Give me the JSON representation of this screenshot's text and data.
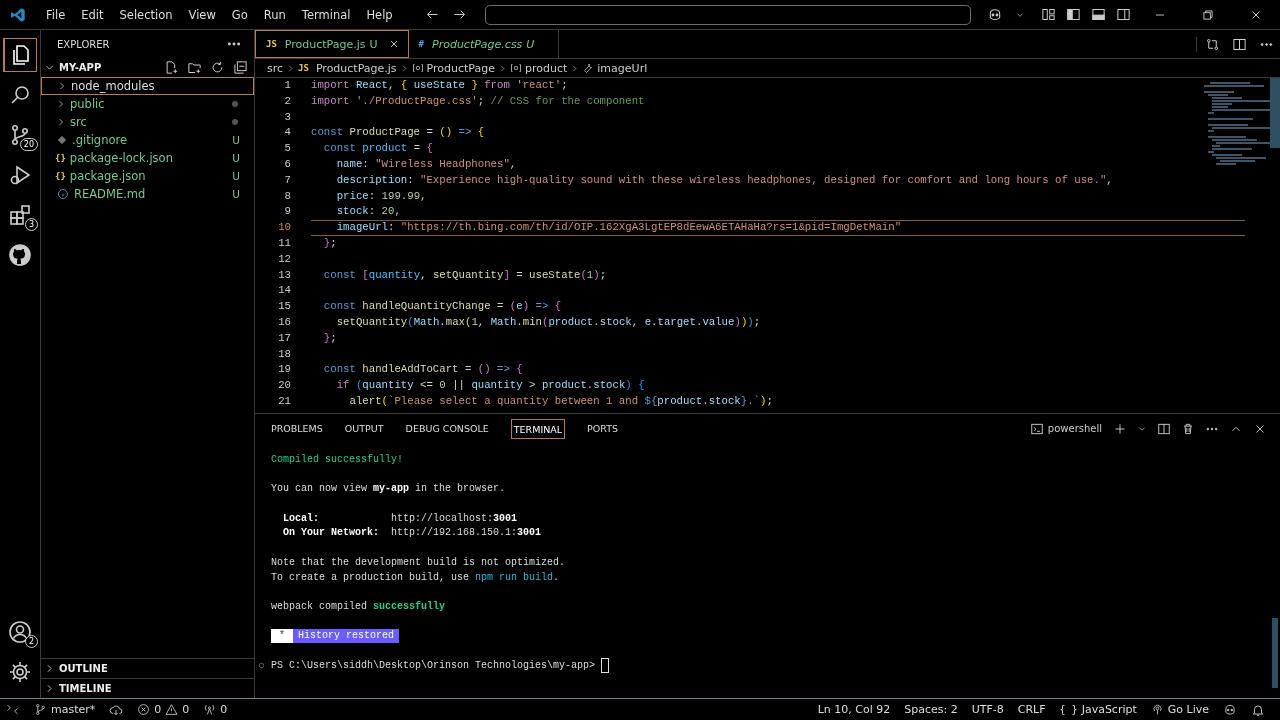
{
  "title_bar": {
    "menus": [
      "File",
      "Edit",
      "Selection",
      "View",
      "Go",
      "Run",
      "Terminal",
      "Help"
    ]
  },
  "activity_bar": {
    "top": [
      {
        "kind": "explorer",
        "selected": true
      },
      {
        "kind": "search",
        "selected": false
      },
      {
        "kind": "source_control",
        "selected": false,
        "badge": "20"
      },
      {
        "kind": "run_debug",
        "selected": false
      },
      {
        "kind": "extensions",
        "selected": false,
        "badge": "3"
      },
      {
        "kind": "github",
        "selected": false
      }
    ],
    "bottom": [
      {
        "kind": "accounts",
        "selected": false,
        "badge": "2"
      },
      {
        "kind": "settings",
        "selected": false
      }
    ]
  },
  "sidebar": {
    "title": "EXPLORER",
    "section": {
      "label": "MY-APP",
      "expanded": true
    },
    "items": [
      {
        "label": "node_modules",
        "kind": "folder",
        "ignored": true,
        "has_changes": false,
        "selected": true
      },
      {
        "label": "public",
        "kind": "folder",
        "ignored": false,
        "has_changes": true,
        "selected": false
      },
      {
        "label": "src",
        "kind": "folder",
        "ignored": false,
        "has_changes": true,
        "selected": false
      },
      {
        "label": ".gitignore",
        "kind": "gitignore",
        "ignored": false,
        "has_changes": false,
        "selected": false,
        "badge": "U"
      },
      {
        "label": "package-lock.json",
        "kind": "json",
        "ignored": false,
        "has_changes": false,
        "selected": false,
        "badge": "U",
        "icon_text": "{}"
      },
      {
        "label": "package.json",
        "kind": "json",
        "ignored": false,
        "has_changes": false,
        "selected": false,
        "badge": "U",
        "icon_text": "{}"
      },
      {
        "label": "README.md",
        "kind": "readme",
        "ignored": false,
        "has_changes": false,
        "selected": false,
        "badge": "U"
      }
    ],
    "bottom_sections": [
      {
        "label": "OUTLINE",
        "expanded": false
      },
      {
        "label": "TIMELINE",
        "expanded": false
      }
    ]
  },
  "tabs": [
    {
      "icon_text": "JS",
      "kind": "js",
      "label": "ProductPage.js",
      "badge": "U",
      "selected": true,
      "preview": false
    },
    {
      "icon_text": "#",
      "kind": "css",
      "label": "ProductPage.css",
      "badge": "U",
      "selected": false,
      "preview": true
    }
  ],
  "breadcrumbs": [
    {
      "kind": "folder",
      "label": "src"
    },
    {
      "kind": "js",
      "icon_text": "JS",
      "label": "ProductPage.js"
    },
    {
      "kind": "variable",
      "label": "ProductPage"
    },
    {
      "kind": "variable",
      "label": "product"
    },
    {
      "kind": "property",
      "label": "imageUrl"
    }
  ],
  "code": {
    "lines": [
      {
        "number": "1",
        "current": false,
        "tokens": [
          {
            "kind": "kw",
            "text": "import "
          },
          {
            "kind": "var",
            "text": "React"
          },
          {
            "kind": "p",
            "text": ", "
          },
          {
            "kind": "b1",
            "text": "{"
          },
          {
            "kind": "var",
            "text": " useState "
          },
          {
            "kind": "b1",
            "text": "}"
          },
          {
            "kind": "kw",
            "text": " from "
          },
          {
            "kind": "str",
            "text": "'react'"
          },
          {
            "kind": "p",
            "text": ";"
          }
        ]
      },
      {
        "number": "2",
        "current": false,
        "tokens": [
          {
            "kind": "kw",
            "text": "import "
          },
          {
            "kind": "str",
            "text": "'./ProductPage.css'"
          },
          {
            "kind": "p",
            "text": "; "
          },
          {
            "kind": "cmt",
            "text": "// CSS for the component"
          }
        ]
      },
      {
        "number": "3",
        "current": false
      },
      {
        "number": "4",
        "current": false,
        "tokens": [
          {
            "kind": "storage",
            "text": "const "
          },
          {
            "kind": "fn",
            "text": "ProductPage"
          },
          {
            "kind": "p",
            "text": " = "
          },
          {
            "kind": "b1",
            "text": "()"
          },
          {
            "kind": "storage",
            "text": " => "
          },
          {
            "kind": "b1",
            "text": "{"
          }
        ]
      },
      {
        "number": "5",
        "current": false,
        "tokens": [
          {
            "kind": "storage",
            "text": "  const "
          },
          {
            "kind": "const",
            "text": "product"
          },
          {
            "kind": "p",
            "text": " = "
          },
          {
            "kind": "b2",
            "text": "{"
          }
        ]
      },
      {
        "number": "6",
        "current": false,
        "tokens": [
          {
            "kind": "var",
            "text": "    name"
          },
          {
            "kind": "p",
            "text": ": "
          },
          {
            "kind": "str",
            "text": "\"Wireless Headphones\""
          },
          {
            "kind": "p",
            "text": ","
          }
        ]
      },
      {
        "number": "7",
        "current": false,
        "tokens": [
          {
            "kind": "var",
            "text": "    description"
          },
          {
            "kind": "p",
            "text": ": "
          },
          {
            "kind": "str",
            "text": "\"Experience high-quality sound with these wireless headphones, designed for comfort and long hours of use.\""
          },
          {
            "kind": "p",
            "text": ","
          }
        ]
      },
      {
        "number": "8",
        "current": false,
        "tokens": [
          {
            "kind": "var",
            "text": "    price"
          },
          {
            "kind": "p",
            "text": ": "
          },
          {
            "kind": "num",
            "text": "199.99"
          },
          {
            "kind": "p",
            "text": ","
          }
        ]
      },
      {
        "number": "9",
        "current": false,
        "tokens": [
          {
            "kind": "var",
            "text": "    stock"
          },
          {
            "kind": "p",
            "text": ": "
          },
          {
            "kind": "num",
            "text": "20"
          },
          {
            "kind": "p",
            "text": ","
          }
        ]
      },
      {
        "number": "10",
        "current": true,
        "tokens": [
          {
            "kind": "var",
            "text": "    imageUrl"
          },
          {
            "kind": "p",
            "text": ": "
          },
          {
            "kind": "str",
            "text": "\"https://th.bing.com/th/id/OIP.162XgA3LgtEP8dEewA6ETAHaHa?rs=1&pid=ImgDetMain\""
          }
        ]
      },
      {
        "number": "11",
        "current": false,
        "tokens": [
          {
            "kind": "b2",
            "text": "  }"
          },
          {
            "kind": "p",
            "text": ";"
          }
        ]
      },
      {
        "number": "12",
        "current": false
      },
      {
        "number": "13",
        "current": false,
        "tokens": [
          {
            "kind": "storage",
            "text": "  const "
          },
          {
            "kind": "b2",
            "text": "["
          },
          {
            "kind": "const",
            "text": "quantity"
          },
          {
            "kind": "p",
            "text": ", "
          },
          {
            "kind": "fn",
            "text": "setQuantity"
          },
          {
            "kind": "b2",
            "text": "]"
          },
          {
            "kind": "p",
            "text": " = "
          },
          {
            "kind": "fn",
            "text": "useState"
          },
          {
            "kind": "b2",
            "text": "("
          },
          {
            "kind": "num",
            "text": "1"
          },
          {
            "kind": "b2",
            "text": ")"
          },
          {
            "kind": "p",
            "text": ";"
          }
        ]
      },
      {
        "number": "14",
        "current": false
      },
      {
        "number": "15",
        "current": false,
        "tokens": [
          {
            "kind": "storage",
            "text": "  const "
          },
          {
            "kind": "fn",
            "text": "handleQuantityChange"
          },
          {
            "kind": "p",
            "text": " = "
          },
          {
            "kind": "b2",
            "text": "("
          },
          {
            "kind": "var",
            "text": "e"
          },
          {
            "kind": "b2",
            "text": ")"
          },
          {
            "kind": "storage",
            "text": " => "
          },
          {
            "kind": "b2",
            "text": "{"
          }
        ]
      },
      {
        "number": "16",
        "current": false,
        "tokens": [
          {
            "kind": "fn",
            "text": "    setQuantity"
          },
          {
            "kind": "b3",
            "text": "("
          },
          {
            "kind": "var",
            "text": "Math"
          },
          {
            "kind": "p",
            "text": "."
          },
          {
            "kind": "fn",
            "text": "max"
          },
          {
            "kind": "b1",
            "text": "("
          },
          {
            "kind": "num",
            "text": "1"
          },
          {
            "kind": "p",
            "text": ", "
          },
          {
            "kind": "var",
            "text": "Math"
          },
          {
            "kind": "p",
            "text": "."
          },
          {
            "kind": "fn",
            "text": "min"
          },
          {
            "kind": "b2",
            "text": "("
          },
          {
            "kind": "var",
            "text": "product"
          },
          {
            "kind": "p",
            "text": "."
          },
          {
            "kind": "var",
            "text": "stock"
          },
          {
            "kind": "p",
            "text": ", "
          },
          {
            "kind": "var",
            "text": "e"
          },
          {
            "kind": "p",
            "text": "."
          },
          {
            "kind": "var",
            "text": "target"
          },
          {
            "kind": "p",
            "text": "."
          },
          {
            "kind": "var",
            "text": "value"
          },
          {
            "kind": "b2",
            "text": ")"
          },
          {
            "kind": "b1",
            "text": ")"
          },
          {
            "kind": "b3",
            "text": ")"
          },
          {
            "kind": "p",
            "text": ";"
          }
        ]
      },
      {
        "number": "17",
        "current": false,
        "tokens": [
          {
            "kind": "b2",
            "text": "  }"
          },
          {
            "kind": "p",
            "text": ";"
          }
        ]
      },
      {
        "number": "18",
        "current": false
      },
      {
        "number": "19",
        "current": false,
        "tokens": [
          {
            "kind": "storage",
            "text": "  const "
          },
          {
            "kind": "fn",
            "text": "handleAddToCart"
          },
          {
            "kind": "p",
            "text": " = "
          },
          {
            "kind": "b2",
            "text": "()"
          },
          {
            "kind": "storage",
            "text": " => "
          },
          {
            "kind": "b2",
            "text": "{"
          }
        ]
      },
      {
        "number": "20",
        "current": false,
        "tokens": [
          {
            "kind": "kw",
            "text": "    if "
          },
          {
            "kind": "b3",
            "text": "("
          },
          {
            "kind": "var",
            "text": "quantity"
          },
          {
            "kind": "p",
            "text": " <= "
          },
          {
            "kind": "num",
            "text": "0"
          },
          {
            "kind": "p",
            "text": " || "
          },
          {
            "kind": "var",
            "text": "quantity"
          },
          {
            "kind": "p",
            "text": " > "
          },
          {
            "kind": "var",
            "text": "product"
          },
          {
            "kind": "p",
            "text": "."
          },
          {
            "kind": "var",
            "text": "stock"
          },
          {
            "kind": "b3",
            "text": ")"
          },
          {
            "kind": "b3",
            "text": " {"
          }
        ]
      },
      {
        "number": "21",
        "current": false,
        "tokens": [
          {
            "kind": "fn",
            "text": "      alert"
          },
          {
            "kind": "b1",
            "text": "("
          },
          {
            "kind": "str",
            "text": "`Please select a quantity between 1 and "
          },
          {
            "kind": "storage",
            "text": "${"
          },
          {
            "kind": "var",
            "text": "product"
          },
          {
            "kind": "p",
            "text": "."
          },
          {
            "kind": "var",
            "text": "stock"
          },
          {
            "kind": "storage",
            "text": "}"
          },
          {
            "kind": "str",
            "text": ".`"
          },
          {
            "kind": "b1",
            "text": ")"
          },
          {
            "kind": "p",
            "text": ";"
          }
        ]
      }
    ]
  },
  "panel": {
    "tabs": [
      {
        "label": "PROBLEMS",
        "selected": false
      },
      {
        "label": "OUTPUT",
        "selected": false
      },
      {
        "label": "DEBUG CONSOLE",
        "selected": false
      },
      {
        "label": "TERMINAL",
        "selected": true
      },
      {
        "label": "PORTS",
        "selected": false
      }
    ],
    "terminal_name": "powershell",
    "blocks": [
      {
        "lines": [
          {
            "tokens": [
              {
                "kind": "green",
                "text": "Compiled successfully!"
              }
            ]
          }
        ]
      },
      {
        "lines": [
          {
            "tokens": [
              {
                "kind": "plain",
                "text": "You can now view "
              },
              {
                "kind": "bold",
                "text": "my-app"
              },
              {
                "kind": "plain",
                "text": " in the browser."
              }
            ]
          }
        ]
      },
      {
        "lines": [
          {
            "tokens": [
              {
                "kind": "bold",
                "text": "  Local:"
              },
              {
                "kind": "plain",
                "text": "            http://localhost:"
              },
              {
                "kind": "bold",
                "text": "3001"
              }
            ]
          },
          {
            "tokens": [
              {
                "kind": "bold",
                "text": "  On Your Network:"
              },
              {
                "kind": "plain",
                "text": "  http://192.168.150.1:"
              },
              {
                "kind": "bold",
                "text": "3001"
              }
            ]
          }
        ]
      },
      {
        "lines": [
          {
            "tokens": [
              {
                "kind": "plain",
                "text": "Note that the development build is not optimized."
              }
            ]
          },
          {
            "tokens": [
              {
                "kind": "plain",
                "text": "To create a production build, use "
              },
              {
                "kind": "cyan",
                "text": "npm run build"
              },
              {
                "kind": "plain",
                "text": "."
              }
            ]
          }
        ]
      },
      {
        "lines": [
          {
            "tokens": [
              {
                "kind": "plain",
                "text": "webpack compiled "
              },
              {
                "kind": "greenbold",
                "text": "successfully"
              }
            ]
          }
        ]
      }
    ],
    "history": {
      "marker": "*",
      "text": "History restored"
    },
    "prompt": "PS C:\\Users\\siddh\\Desktop\\Orinson Technologies\\my-app>"
  },
  "status_bar": {
    "left": [
      {
        "kind": "remote"
      },
      {
        "kind": "branch",
        "text": "master*"
      },
      {
        "kind": "sync"
      },
      {
        "kind": "problems",
        "errors": "0",
        "warnings": "0"
      },
      {
        "kind": "ports",
        "text": "0"
      }
    ],
    "right": [
      {
        "kind": "text",
        "text": "Ln 10, Col 92"
      },
      {
        "kind": "text",
        "text": "Spaces: 2"
      },
      {
        "kind": "text",
        "text": "UTF-8"
      },
      {
        "kind": "text",
        "text": "CRLF"
      },
      {
        "kind": "language",
        "icon_text": "{ }",
        "text": "JavaScript"
      },
      {
        "kind": "golive",
        "text": "Go Live"
      },
      {
        "kind": "copilot"
      },
      {
        "kind": "bell"
      }
    ]
  }
}
